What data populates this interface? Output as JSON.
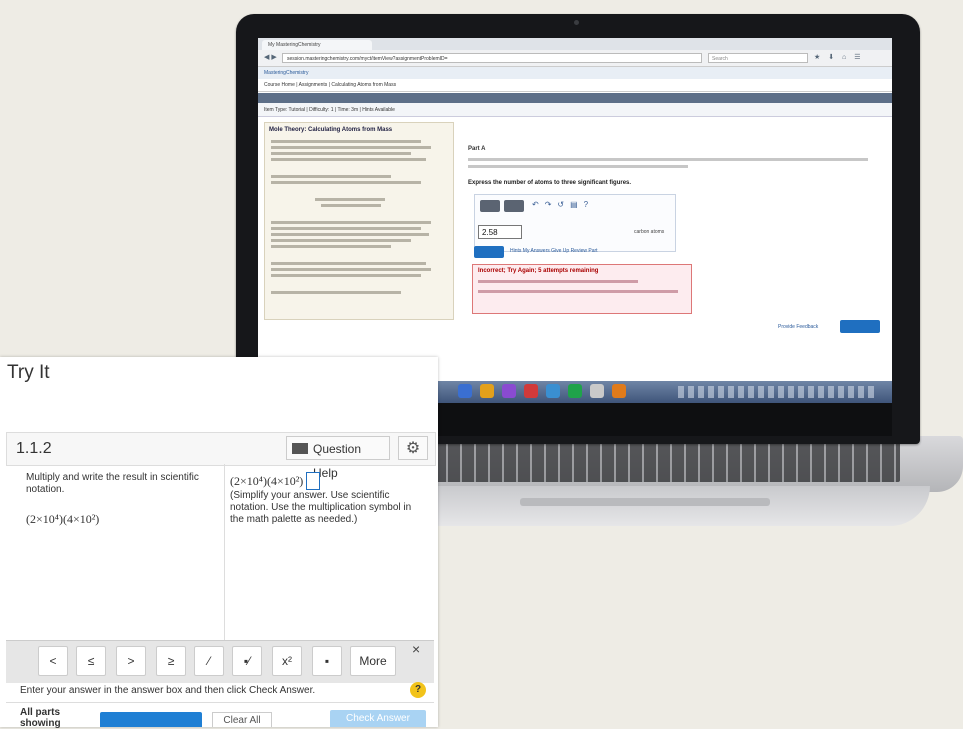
{
  "laptop": {
    "browser": {
      "tab_title": "My MasteringChemistry",
      "url": "session.masteringchemistry.com/myct/itemView?assignmentProblemID=",
      "search_placeholder": "Search"
    },
    "site": {
      "header": "MasteringChemistry",
      "breadcrumb": "Course Home | Assignments | Calculating Atoms from Mass",
      "item_bar": "Item Type: Tutorial | Difficulty: 1 | Time: 3m | Hints Available"
    },
    "left_pane_title": "Mole Theory: Calculating Atoms from Mass",
    "part_label": "Part A",
    "express_text": "Express the number of atoms to three significant figures.",
    "answer_value": "2.58",
    "units_label": "carbon atoms",
    "links_text": "Hints My Answers Give Up Review Part",
    "feedback_title": "Incorrect; Try Again; 5 attempts remaining",
    "provide_feedback": "Provide Feedback",
    "taskbar_icon_colors": [
      "#3a6fd1",
      "#e3a01b",
      "#8a4bd1",
      "#d13a3a",
      "#3a8fd1",
      "#1fa34a",
      "#c9c9c9",
      "#e07b1b"
    ]
  },
  "tryit": {
    "title": "Try It",
    "question_number": "1.1.2",
    "question_help": "Question Help",
    "settings_icon": "gear-icon",
    "instruction": "Multiply and write the result in scientific notation.",
    "expression_left": "(2×10⁴)(4×10²)",
    "expression_right": "(2×10⁴)(4×10²) =",
    "hint": "(Simplify your answer. Use scientific notation. Use the multiplication symbol in the math palette as needed.)",
    "palette_keys": [
      "<",
      "≤",
      ">",
      "≥",
      "⁄",
      "▪⁄",
      "x²",
      "▪",
      "More"
    ],
    "palette_close": "×",
    "enter_text": "Enter your answer in the answer box and then click Check Answer.",
    "help_symbol": "?",
    "all_parts": "All parts showing",
    "clear_all": "Clear All",
    "check_answer": "Check Answer"
  }
}
